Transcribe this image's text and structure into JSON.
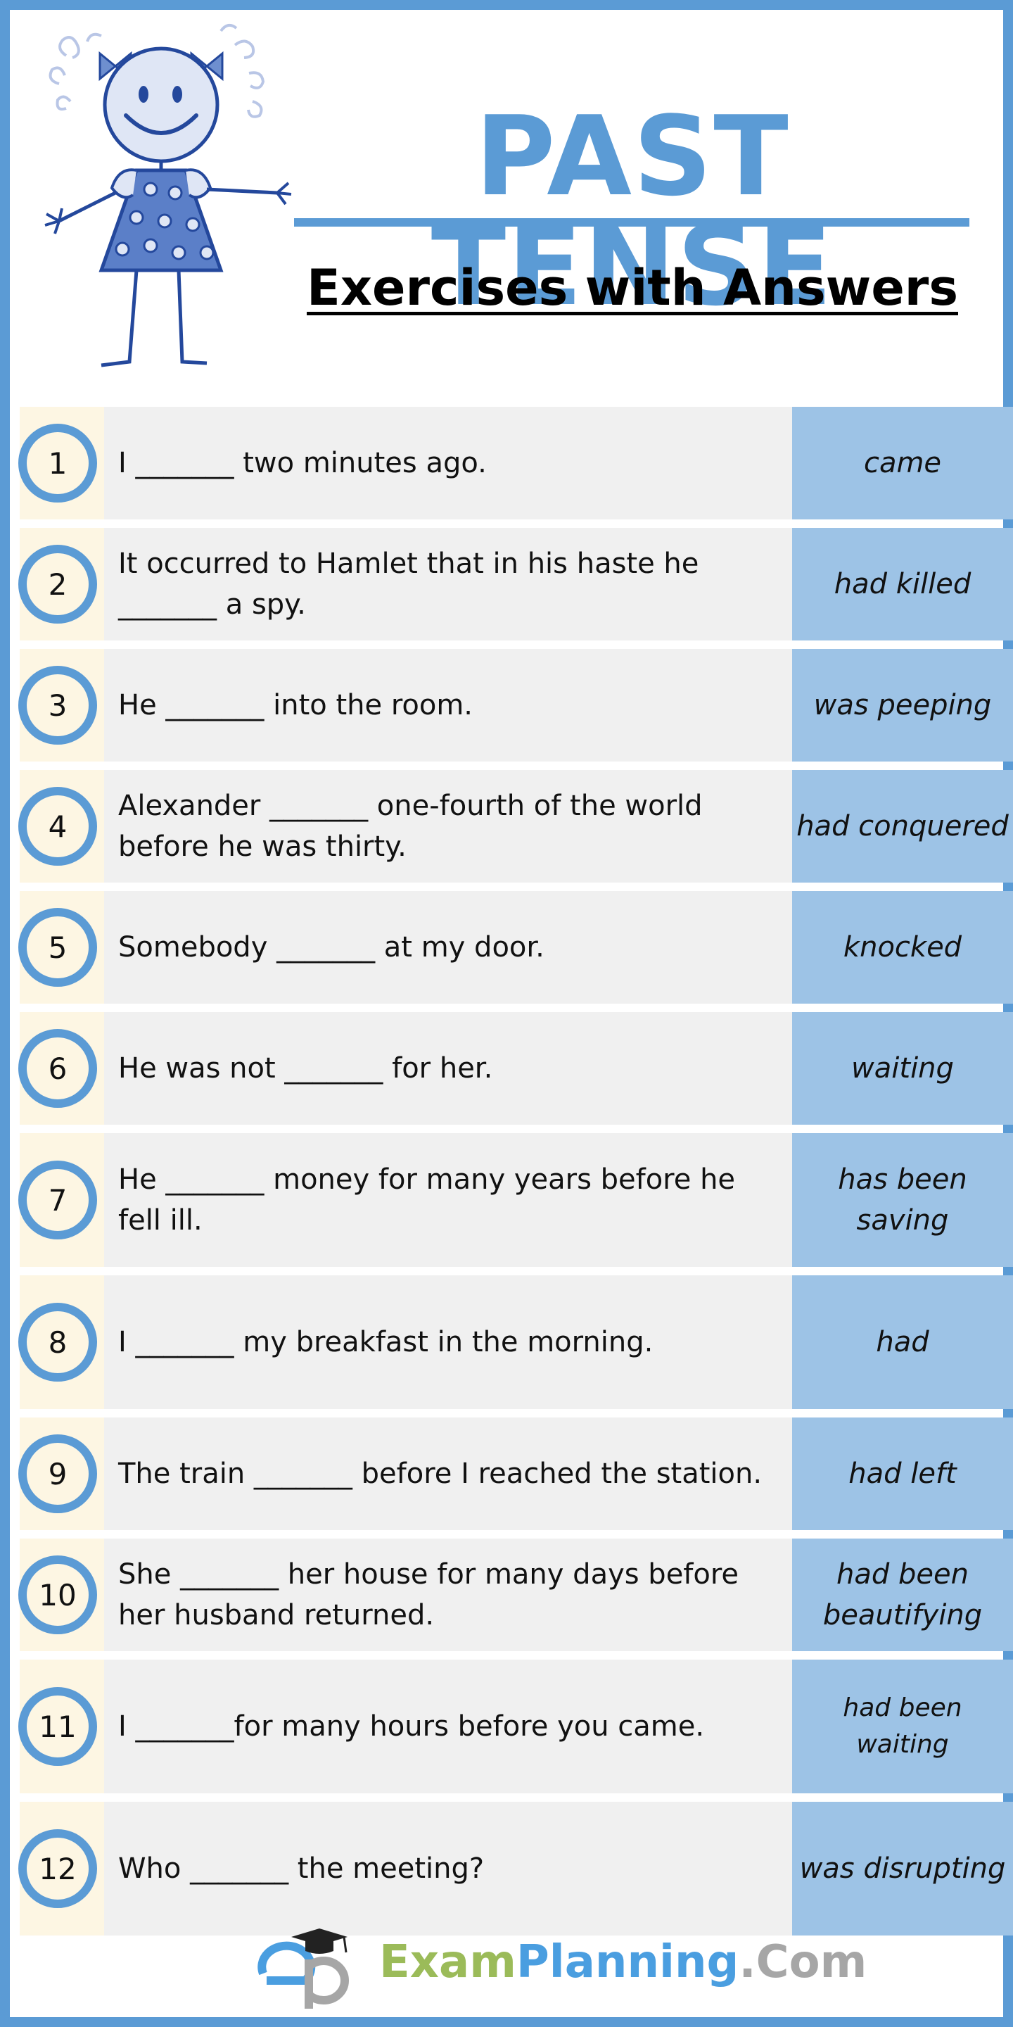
{
  "header": {
    "title": "PAST TENSE",
    "subtitle": "Exercises with Answers"
  },
  "exercises": [
    {
      "number": "1",
      "question": "I _______ two minutes ago.",
      "answer": "came"
    },
    {
      "number": "2",
      "question": "It occurred to Hamlet that in his haste he _______ a spy.",
      "answer": "had killed"
    },
    {
      "number": "3",
      "question": "He _______ into the room.",
      "answer": "was peeping"
    },
    {
      "number": "4",
      "question": "Alexander _______ one-fourth of the world before he was thirty.",
      "answer": "had conquered"
    },
    {
      "number": "5",
      "question": "Somebody _______ at my door.",
      "answer": "knocked"
    },
    {
      "number": "6",
      "question": "He was not _______ for her.",
      "answer": "waiting"
    },
    {
      "number": "7",
      "question": "He _______ money for many years before he fell ill.",
      "answer": "has been saving"
    },
    {
      "number": "8",
      "question": "I _______ my breakfast in the morning.",
      "answer": "had"
    },
    {
      "number": "9",
      "question": "The train _______ before I reached the station.",
      "answer": "had left"
    },
    {
      "number": "10",
      "question": "She _______ her house for many days before her husband returned.",
      "answer": "had been beautifying"
    },
    {
      "number": "11",
      "question": "I _______for many hours before you came.",
      "answer": "had been waiting"
    },
    {
      "number": "12",
      "question": "Who _______ the meeting?",
      "answer": "was disrupting"
    }
  ],
  "footer": {
    "brand_part1": "Exam",
    "brand_part2": "Planning",
    "brand_part3": ".Com",
    "logo_icon": "ep-graduation-cap-logo"
  },
  "colors": {
    "accent_blue": "#5b9bd5",
    "answer_bg": "#9dc3e6",
    "question_bg": "#f0f0f0",
    "number_bg": "#fdf6e3"
  }
}
